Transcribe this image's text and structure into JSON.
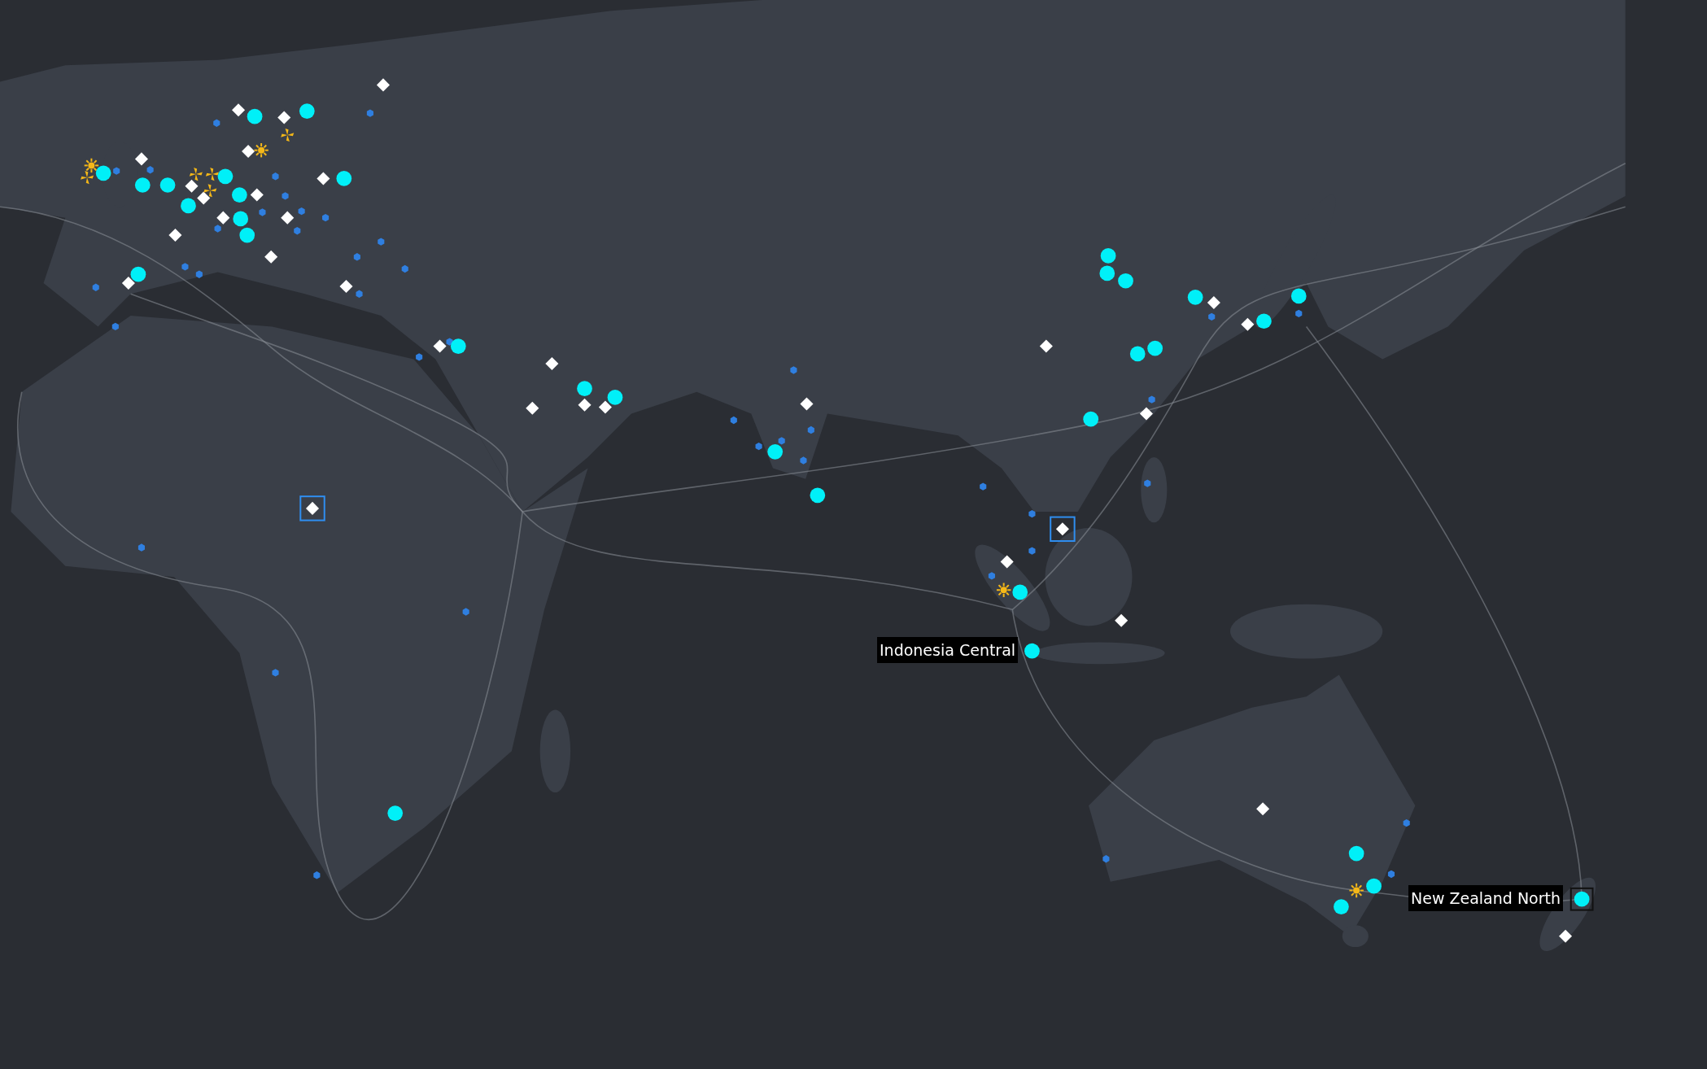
{
  "map": {
    "labels": [
      {
        "text": "Indonesia Central"
      },
      {
        "text": "New Zealand North"
      }
    ]
  }
}
